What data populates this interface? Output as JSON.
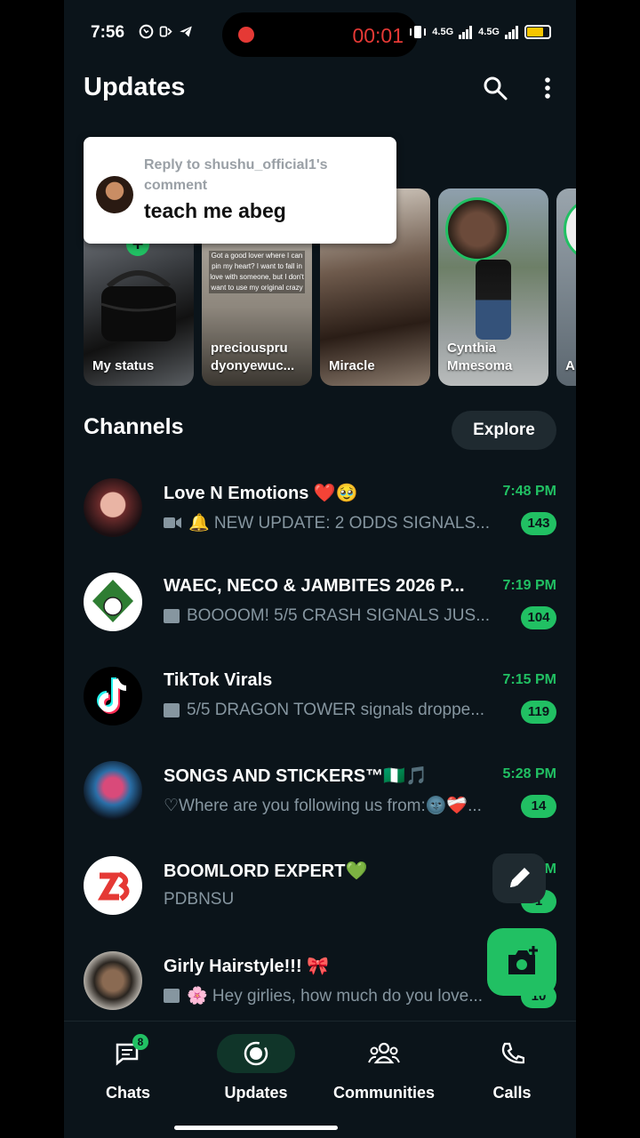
{
  "statusbar": {
    "time": "7:56",
    "record_timer": "00:01",
    "network_1": "4.5G",
    "network_2": "4.5G",
    "left_icons": [
      "whatsapp-icon",
      "data-icon",
      "telegram-icon"
    ]
  },
  "header": {
    "title": "Updates",
    "icons": [
      "search-icon",
      "more-vert-icon"
    ]
  },
  "reply_popup": {
    "meta": "Reply to shushu_official1's comment",
    "text": "teach me abeg"
  },
  "status": {
    "items": [
      {
        "label": "My status"
      },
      {
        "label": "preciouspru dyonyewuc..."
      },
      {
        "label": "Miracle"
      },
      {
        "label": "Cynthia Mmesoma"
      },
      {
        "label": "A"
      }
    ],
    "preview_text": "Got a good lover where I can pin my heart? I want to fall in love with someone, but I don't want to use my original crazy"
  },
  "channels": {
    "title": "Channels",
    "explore_label": "Explore",
    "items": [
      {
        "name": "Love N Emotions ❤️🥹",
        "time": "7:48 PM",
        "message": "🔔 NEW UPDATE: 2 ODDS SIGNALS...",
        "unread": "143",
        "icon": "video-icon"
      },
      {
        "name": "WAEC, NECO & JAMBITES 2026 P...",
        "time": "7:19 PM",
        "message": "BOOOOM! 5/5 CRASH SIGNALS JUS...",
        "unread": "104",
        "icon": "image-icon"
      },
      {
        "name": "TikTok Virals",
        "time": "7:15 PM",
        "message": "5/5 DRAGON TOWER signals droppe...",
        "unread": "119",
        "icon": "image-icon"
      },
      {
        "name": "SONGS AND STICKERS™🇳🇬🎵",
        "time": "5:28 PM",
        "message": "♡Where are you following us from:🌚❤️‍🩹...",
        "unread": "14",
        "icon": ""
      },
      {
        "name": "BOOMLORD EXPERT💚",
        "time": "M",
        "message": "PDBNSU",
        "unread": "1",
        "icon": ""
      },
      {
        "name": "Girly Hairstyle!!! 🎀",
        "time": "",
        "message": "🌸 Hey girlies, how much do you love...",
        "unread": "10",
        "icon": "image-icon"
      }
    ]
  },
  "fabs": {
    "pencil": "pencil-icon",
    "camera": "camera-add-icon"
  },
  "bottom_nav": {
    "items": [
      {
        "label": "Chats",
        "badge": "8"
      },
      {
        "label": "Updates"
      },
      {
        "label": "Communities"
      },
      {
        "label": "Calls"
      }
    ],
    "active": "Updates"
  },
  "colors": {
    "accent": "#21c063",
    "background": "#0b141a",
    "muted": "#8696a0"
  }
}
